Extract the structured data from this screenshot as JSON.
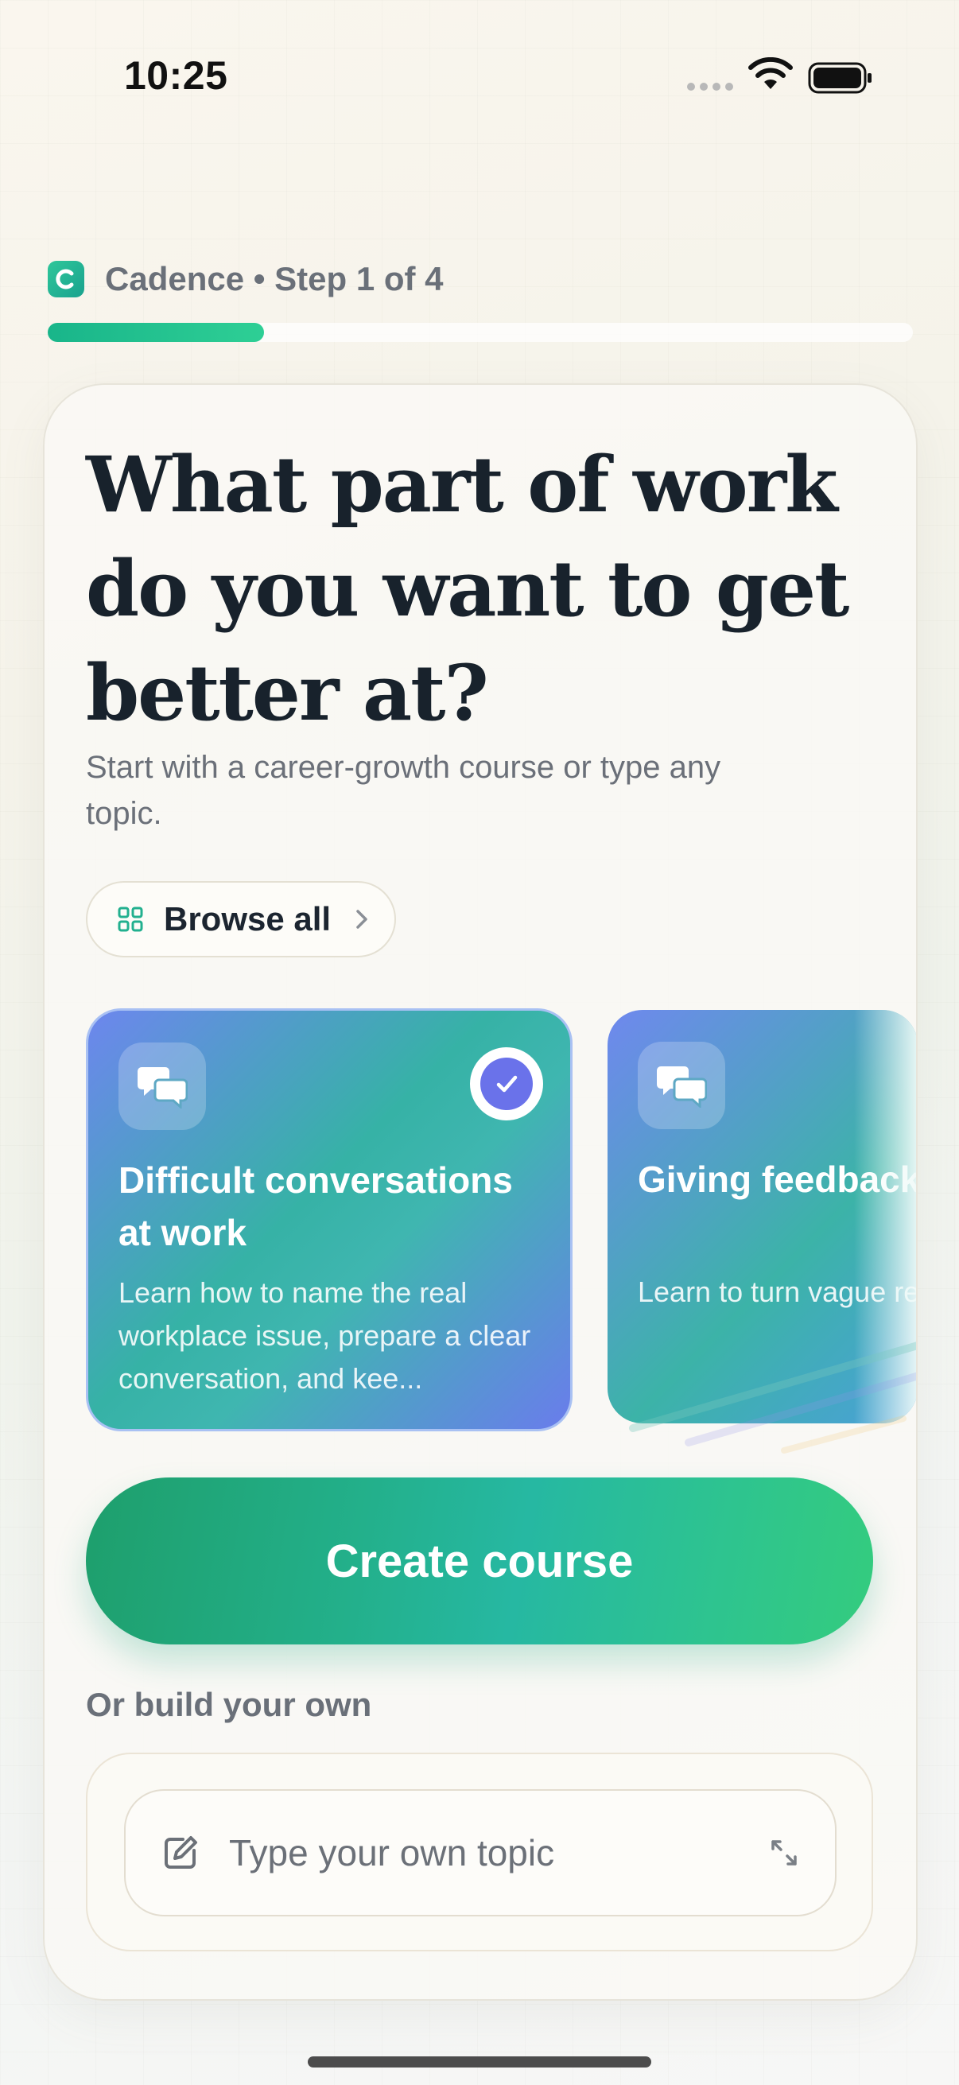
{
  "status_bar": {
    "time": "10:25"
  },
  "header": {
    "brand": "Cadence",
    "separator": "•",
    "step": "Step 1 of 4",
    "progress_fraction": 0.25
  },
  "main": {
    "headline": "What part of work do you want to get better at?",
    "subtitle": "Start with a career-growth course or type any topic.",
    "browse_all_label": "Browse all",
    "courses": [
      {
        "title": "Difficult conversations at work",
        "description": "Learn how to name the real workplace issue, prepare a clear conversation, and kee...",
        "selected": true,
        "icon": "chat-bubbles-icon"
      },
      {
        "title": "Giving feedback that lands",
        "description": "Learn to turn vague reactions into feedback that points to observable behavior.",
        "selected": false,
        "icon": "chat-bubbles-icon"
      }
    ],
    "create_button": "Create course",
    "or_build_label": "Or build your own",
    "topic_input": {
      "placeholder": "Type your own topic",
      "value": ""
    }
  },
  "colors": {
    "accent_green": "#22b58a",
    "selection_purple": "#6a72ea",
    "text_dark": "#18222c"
  }
}
